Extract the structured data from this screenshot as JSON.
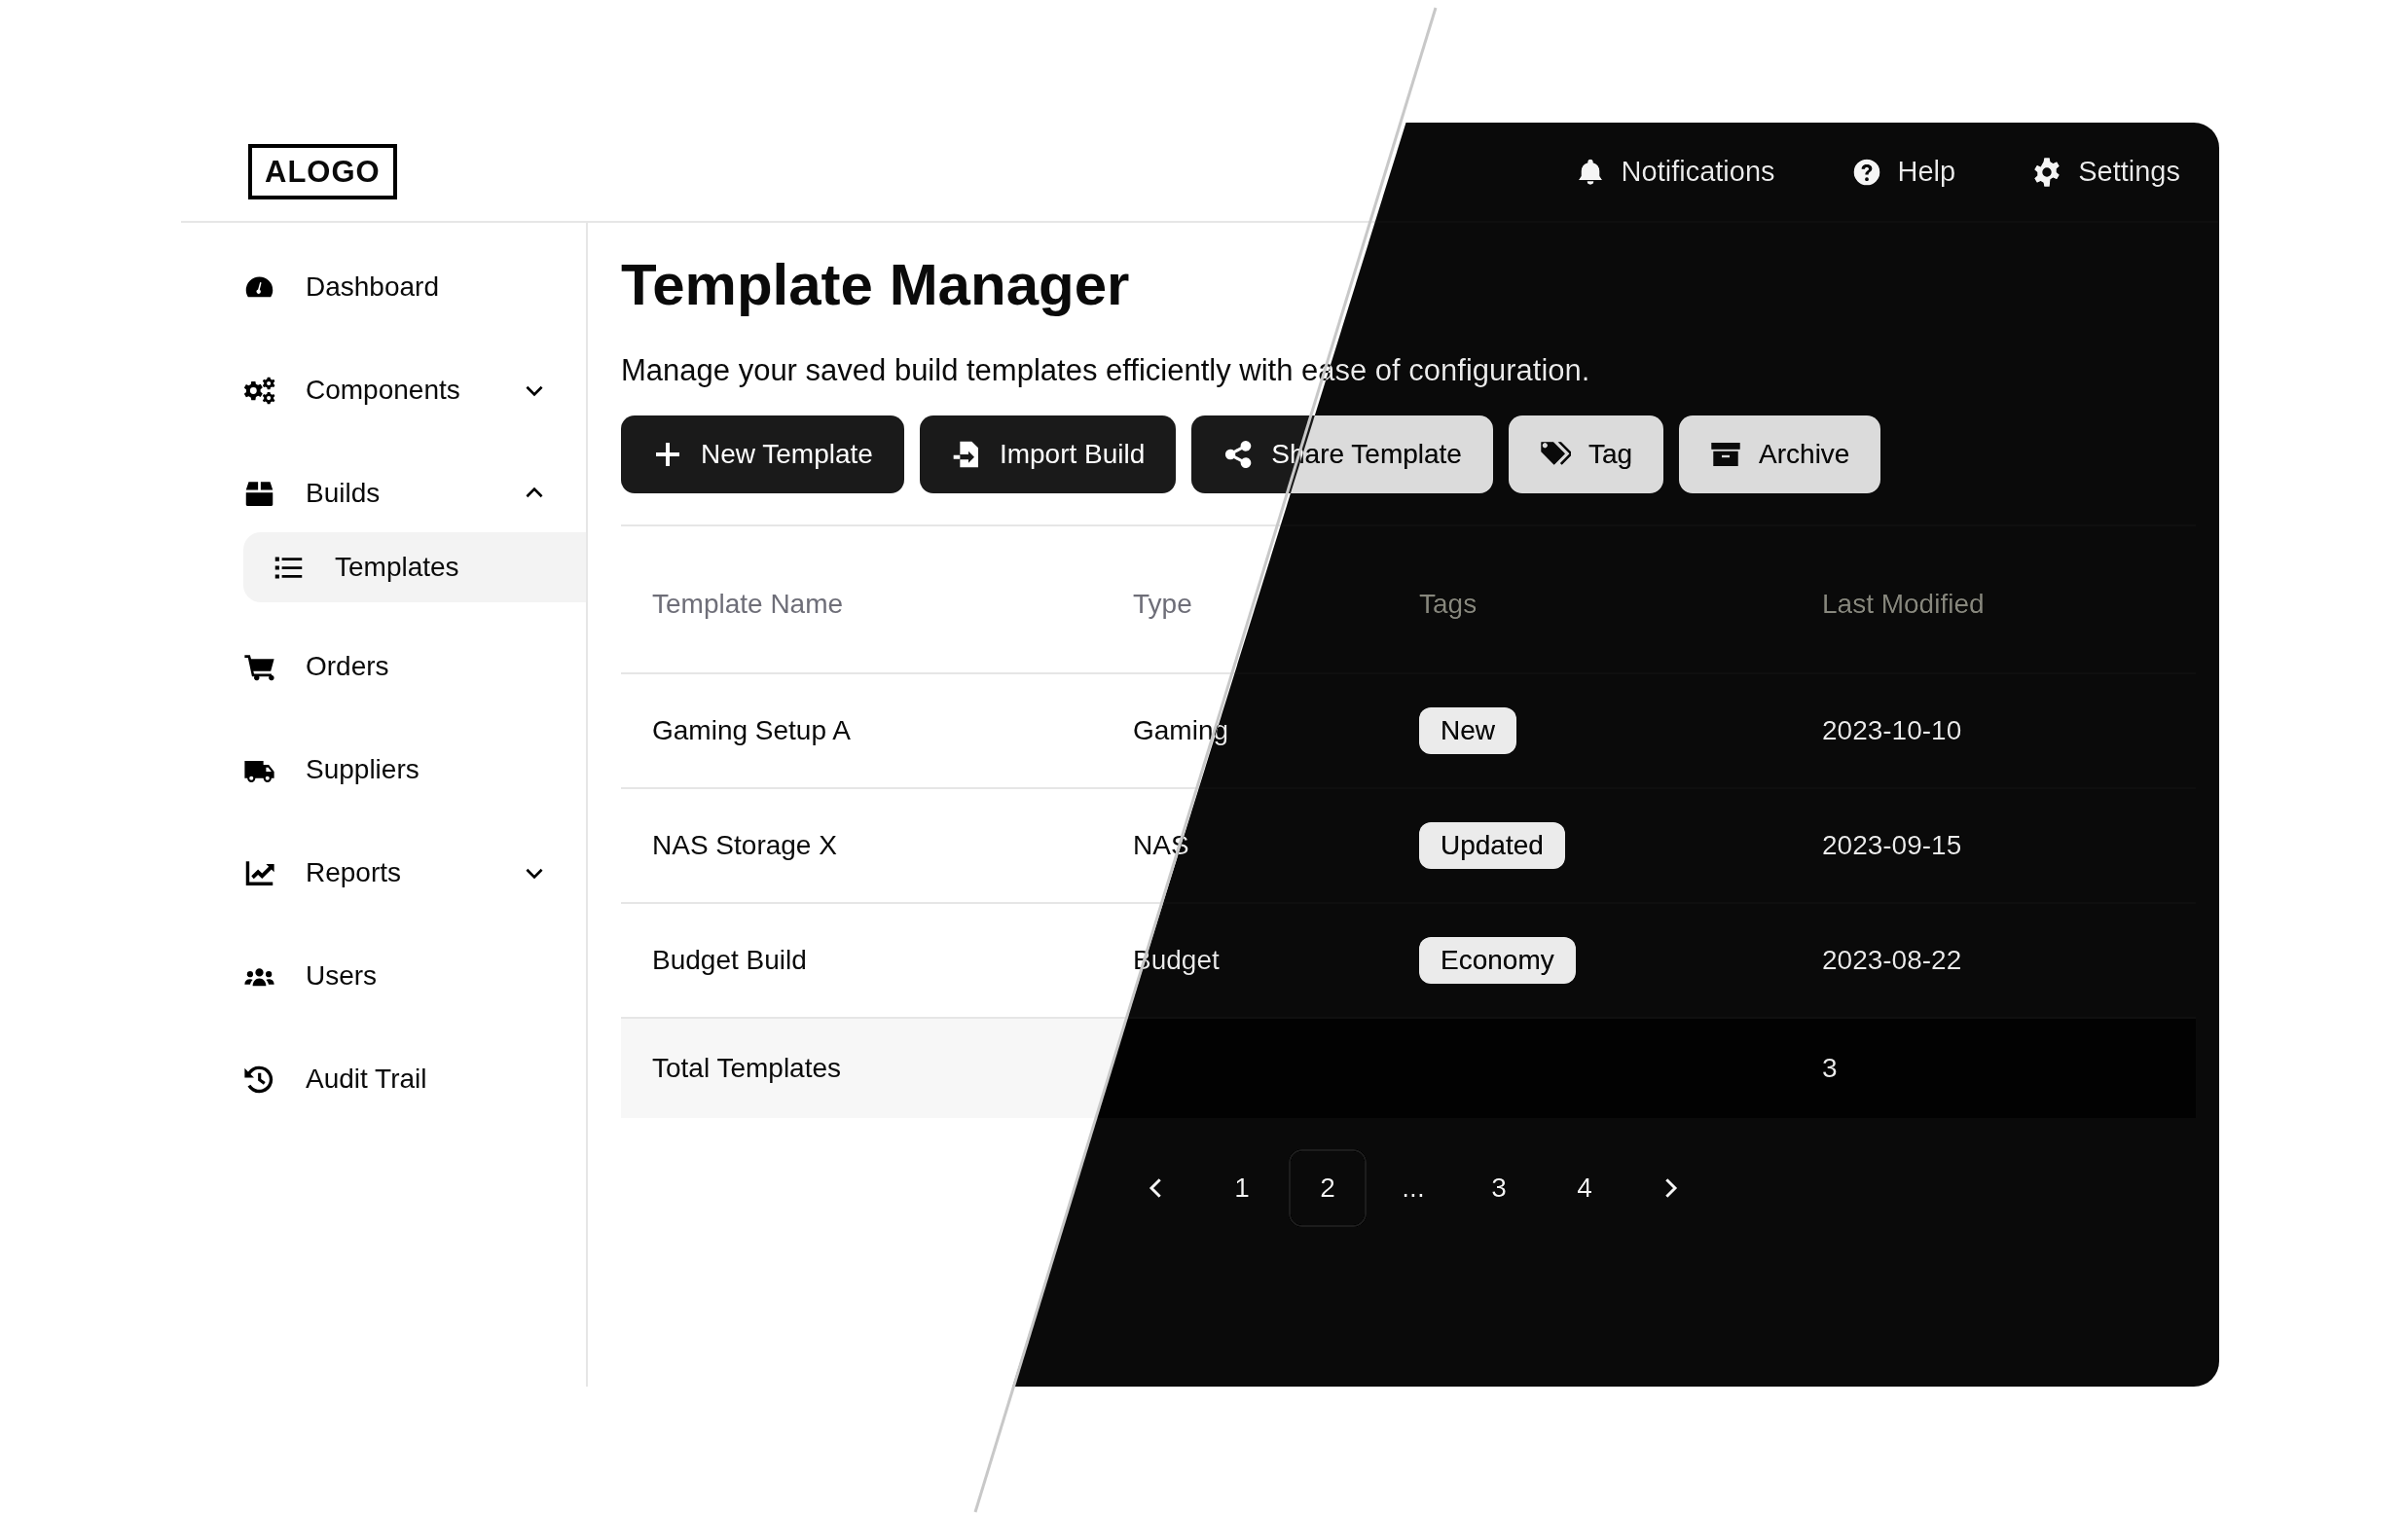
{
  "logo": "ALOGO",
  "top_nav": [
    {
      "label": "Notifications"
    },
    {
      "label": "Help"
    },
    {
      "label": "Settings"
    }
  ],
  "sidebar": {
    "items": [
      {
        "label": "Dashboard",
        "selected": false
      },
      {
        "label": "Components",
        "selected": false,
        "expanded": false
      },
      {
        "label": "Builds",
        "selected": false,
        "expanded": true,
        "children": [
          {
            "label": "Templates",
            "selected": true
          }
        ]
      },
      {
        "label": "Orders",
        "selected": false
      },
      {
        "label": "Suppliers",
        "selected": false
      },
      {
        "label": "Reports",
        "selected": false,
        "expanded": false
      },
      {
        "label": "Users",
        "selected": false
      },
      {
        "label": "Audit Trail",
        "selected": false
      }
    ]
  },
  "page": {
    "title": "Template Manager",
    "subtitle": "Manage your saved build templates efficiently with ease of configuration.",
    "actions": [
      {
        "label": "New Template",
        "kind": "primary"
      },
      {
        "label": "Import Build",
        "kind": "primary"
      },
      {
        "label": "Share Template",
        "kind": "primary"
      },
      {
        "label": "Tag",
        "kind": "primary"
      },
      {
        "label": "Archive",
        "kind": "primary"
      }
    ]
  },
  "table": {
    "columns": [
      "Template Name",
      "Type",
      "Tags",
      "Last Modified"
    ],
    "rows": [
      {
        "name": "Gaming Setup A",
        "type": "Gaming",
        "tag": "New",
        "modified": "2023-10-10"
      },
      {
        "name": "NAS Storage X",
        "type": "NAS",
        "tag": "Updated",
        "modified": "2023-09-15"
      },
      {
        "name": "Budget Build",
        "type": "Budget",
        "tag": "Economy",
        "modified": "2023-08-22"
      }
    ],
    "total": {
      "label": "Total Templates",
      "value": "3"
    }
  },
  "pagination": {
    "pages": [
      {
        "label": "1",
        "selected": false
      },
      {
        "label": "2",
        "selected": true
      },
      {
        "label": "...",
        "selected": false
      },
      {
        "label": "3",
        "selected": false
      },
      {
        "label": "4",
        "selected": false
      }
    ]
  }
}
